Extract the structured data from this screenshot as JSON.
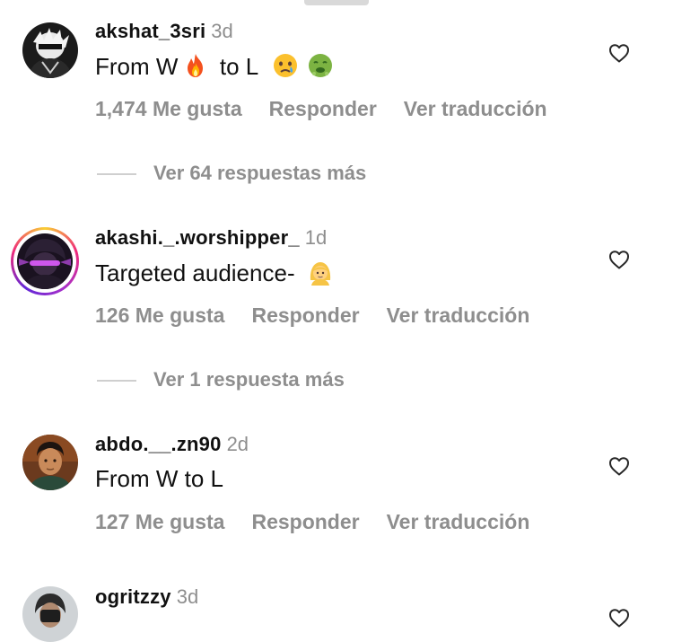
{
  "comments": [
    {
      "username": "akshat_3sri",
      "time": "3d",
      "text_parts": [
        "From W",
        "to L"
      ],
      "emojis": [
        "fire-emoji",
        "crying-face-emoji",
        "nauseated-face-emoji"
      ],
      "likes": "1,474 Me gusta",
      "reply": "Responder",
      "translate": "Ver traducción",
      "more_replies": "Ver 64 respuestas más"
    },
    {
      "username": "akashi._.worshipper_",
      "time": "1d",
      "text": "Targeted audience-",
      "emojis": [
        "person-blond-hair-emoji"
      ],
      "likes": "126 Me gusta",
      "reply": "Responder",
      "translate": "Ver traducción",
      "more_replies": "Ver 1 respuesta más"
    },
    {
      "username": "abdo.__.zn90",
      "time": "2d",
      "text": "From W to L",
      "likes": "127 Me gusta",
      "reply": "Responder",
      "translate": "Ver traducción"
    },
    {
      "username": "ogritzzy",
      "time": "3d"
    }
  ],
  "icons": {
    "like": "heart-outline-icon"
  },
  "colors": {
    "secondary_text": "#8e8e8e",
    "story_ring_start": "#f9ce34",
    "story_ring_mid": "#ee2a7b",
    "story_ring_end": "#6228d7"
  }
}
